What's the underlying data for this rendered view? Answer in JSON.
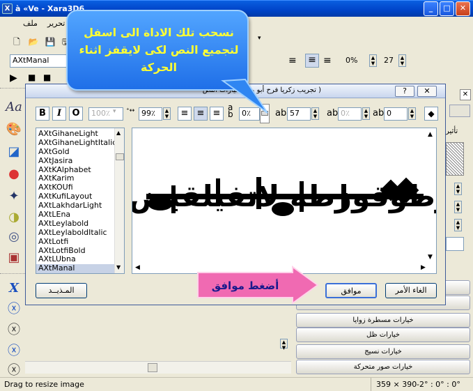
{
  "window": {
    "title": "à «Ve - Xara3D6",
    "min": "_",
    "max": "□",
    "close": "✕"
  },
  "menubar": {
    "items": [
      "ملف",
      "تحرير"
    ]
  },
  "toolbar": {
    "font_value": "AXtManal",
    "percent_value": "0%",
    "size_value": "27"
  },
  "dialog": {
    "title": "( تجريب زكريا فرح أبو وائل  خيارات النص",
    "help": "?",
    "close": "✕",
    "bold": "B",
    "italic": "I",
    "outline": "O",
    "size_value": "100٪",
    "width_value": "99٪",
    "lean_value": "0٪",
    "spacing_value": "57",
    "kerning_value": "0٪",
    "baseline_value": "0",
    "fonts": [
      "AXtGihaneLight",
      "AXtGihaneLightItalic",
      "AXtGold",
      "AXtJasira",
      "AXtKAlphabet",
      "AXtKarim",
      "AXtKOUfi",
      "AXtKufiLayout",
      "AXtLakhdarLight",
      "AXtLEna",
      "AXtLeylabold",
      "AXtLeylaboldItalic",
      "AXtLotfi",
      "AXtLotfiBold",
      "AXtLUbna",
      "AXtManal"
    ],
    "selected_font_index": 15,
    "preview_text": "بيوطوقوزطه لاتفيلقيض ي",
    "buttons": {
      "advanced": "المـذيــد",
      "ok": "موافق",
      "cancel": "الغاء الأمر"
    }
  },
  "callouts": {
    "top": "نسحب تلك الاداة الى اسفل لتجميع النص لكى لايقفز اثناء الحركة",
    "bottom": "أضغط موافق"
  },
  "right_panel": {
    "label": "تأثير",
    "buttons": [
      "خيارات مسطرة زوايا",
      "خيارات ظل",
      "خيارات نسيج",
      "خيارات صور متحركة"
    ]
  },
  "status": {
    "left": "Drag to resize image",
    "size": "359 × 390",
    "angles": "-2° : 0° : 0°"
  },
  "colors": {
    "callout_bg": "#2f86f2",
    "callout_text": "#ffff33",
    "arrow_pink": "#f06ab2",
    "arrow_text": "#1a1a8c"
  }
}
